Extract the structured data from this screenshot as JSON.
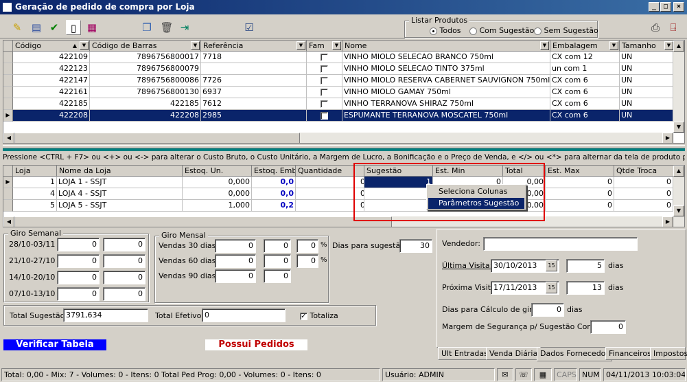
{
  "window": {
    "title": "Geração de pedido de compra por Loja"
  },
  "listar": {
    "legend": "Listar Produtos",
    "options": [
      "Todos",
      "Com Sugestão",
      "Sem Sugestão"
    ],
    "selected": "Todos"
  },
  "products": {
    "columns": [
      "Código",
      "Código de Barras",
      "Referência",
      "Fam",
      "Nome",
      "Embalagem",
      "Tamanho"
    ],
    "rows": [
      {
        "codigo": "422109",
        "barras": "7896756800017",
        "ref": "7718",
        "nome": "VINHO MIOLO SELECAO BRANCO 750ml",
        "emb": "CX com 12",
        "tam": "UN"
      },
      {
        "codigo": "422123",
        "barras": "7896756800079",
        "ref": "",
        "nome": "VINHO MIOLO SELECAO TINTO 375ml",
        "emb": "un com 1",
        "tam": "UN"
      },
      {
        "codigo": "422147",
        "barras": "7896756800086",
        "ref": "7726",
        "nome": "VINHO MIOLO RESERVA CABERNET SAUVIGNON 750ml",
        "emb": "CX com 6",
        "tam": "UN"
      },
      {
        "codigo": "422161",
        "barras": "7896756800130",
        "ref": "6937",
        "nome": "VINHO MIOLO GAMAY 750ml",
        "emb": "CX com 6",
        "tam": "UN"
      },
      {
        "codigo": "422185",
        "barras": "422185",
        "ref": "7612",
        "nome": "VINHO TERRANOVA SHIRAZ 750ml",
        "emb": "CX com 6",
        "tam": "UN"
      },
      {
        "codigo": "422208",
        "barras": "422208",
        "ref": "2985",
        "nome": "ESPUMANTE TERRANOVA MOSCATEL 750ml",
        "emb": "CX com 6",
        "tam": "UN"
      }
    ]
  },
  "hint": "Pressione <CTRL + F7> ou <+> ou <-> para alterar o Custo Bruto, o Custo Unitário, a Margem de Lucro, a Bonificação e o Preço de Venda, e </> ou <*> para alternar da tela de produto para loja.",
  "stores": {
    "columns": [
      "Loja",
      "Nome da Loja",
      "Estoq. Un.",
      "Estoq. Emb",
      "Quantidade",
      "Sugestão",
      "Est. Min",
      "Total",
      "Est. Max",
      "Qtde Troca"
    ],
    "rows": [
      {
        "loja": "1",
        "nome": "LOJA 1 - SSJT",
        "estun": "0,000",
        "estemb": "0,0",
        "qtd": "0",
        "sug": "1",
        "min": "0",
        "total": "0,00",
        "max": "0",
        "troca": "0"
      },
      {
        "loja": "4",
        "nome": "LOJA 4 - SSJT",
        "estun": "0,000",
        "estemb": "0,0",
        "qtd": "0",
        "sug": "",
        "min": "",
        "total": "0,00",
        "max": "0",
        "troca": "0"
      },
      {
        "loja": "5",
        "nome": "LOJA 5 - SSJT",
        "estun": "1,000",
        "estemb": "0,2",
        "qtd": "0",
        "sug": "",
        "min": "",
        "total": "0,00",
        "max": "0",
        "troca": "0"
      }
    ]
  },
  "context_menu": {
    "items": [
      "Seleciona Colunas",
      "Parâmetros Sugestão"
    ],
    "highlighted": "Parâmetros Sugestão"
  },
  "giro_semanal": {
    "legend": "Giro Semanal",
    "rows": [
      {
        "label": "28/10-03/11",
        "v1": "0",
        "v2": "0"
      },
      {
        "label": "21/10-27/10",
        "v1": "0",
        "v2": "0"
      },
      {
        "label": "14/10-20/10",
        "v1": "0",
        "v2": "0"
      },
      {
        "label": "07/10-13/10",
        "v1": "0",
        "v2": "0"
      }
    ]
  },
  "giro_mensal": {
    "legend": "Giro Mensal",
    "rows": [
      {
        "label": "Vendas 30 dias:",
        "v1": "0",
        "v2": "0",
        "v3": "0",
        "pct": "%"
      },
      {
        "label": "Vendas 60 dias:",
        "v1": "0",
        "v2": "0",
        "v3": "0",
        "pct": "%"
      },
      {
        "label": "Vendas 90 dias:",
        "v1": "0",
        "v2": "0"
      }
    ]
  },
  "dias_sugestao": {
    "label": "Dias para sugestão:",
    "value": "30"
  },
  "totals": {
    "sugestao_label": "Total Sugestão:",
    "sugestao": "3791,634",
    "efetivo_label": "Total Efetivo:",
    "efetivo": "0",
    "totaliza_label": "Totaliza",
    "totaliza": true
  },
  "buttons": {
    "verificar": "Verificar Tabela",
    "possui": "Possui Pedidos"
  },
  "fornecedor": {
    "vendedor_label": "Vendedor:",
    "vendedor": "",
    "ultima_label": "Última Visita:",
    "ultima": "30/10/2013",
    "ultima_dias": "5",
    "proxima_label": "Próxima Visita:",
    "proxima": "17/11/2013",
    "proxima_dias": "13",
    "dias_label": "dias",
    "calculo_label": "Dias para Cálculo de giro:",
    "calculo": "0",
    "calculo_dias": "dias",
    "margem_label": "Margem de Segurança p/ Sugestão Compra:",
    "margem": "0"
  },
  "tabs": [
    "Ult Entradas",
    "Venda Diária",
    "Dados Fornecedor",
    "Financeiros",
    "Impostos"
  ],
  "active_tab": "Dados Fornecedor",
  "status": {
    "summary": "Total: 0,00 - Mix: 7 - Volumes: 0 - Itens: 0  Total Ped Prog: 0,00 - Volumes: 0 - Itens: 0",
    "usuario": "Usuário: ADMIN",
    "caps": "CAPS",
    "num": "NUM",
    "datetime": "04/11/2013 10:03:04"
  },
  "colors": {
    "title_start": "#0a246a",
    "title_end": "#3a6ea5",
    "selection": "#0a246a",
    "highlight": "#e00000",
    "verify_bg": "#0000ff",
    "possui_fg": "#c00000"
  }
}
